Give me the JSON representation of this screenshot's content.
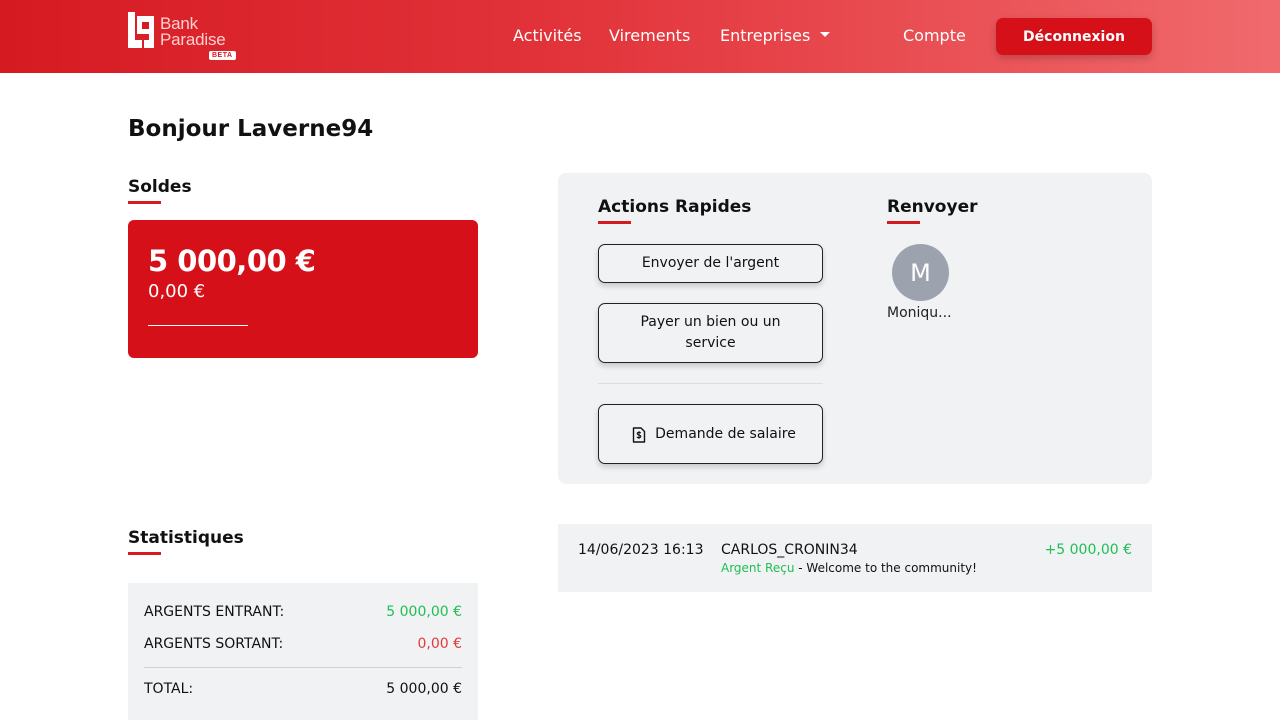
{
  "brand": {
    "line1": "Bank",
    "line2": "Paradise",
    "badge": "BETA"
  },
  "nav": {
    "activites": "Activités",
    "virements": "Virements",
    "entreprises": "Entreprises",
    "compte": "Compte",
    "logout": "Déconnexion"
  },
  "greeting": "Bonjour Laverne94",
  "soldes": {
    "title": "Soldes",
    "main": "5 000,00 €",
    "sub": "0,00 €"
  },
  "quick_actions": {
    "title": "Actions Rapides",
    "send": "Envoyer de l'argent",
    "pay": "Payer un bien ou un service",
    "salary": "Demande de salaire"
  },
  "renvoyer": {
    "title": "Renvoyer",
    "contact_initial": "M",
    "contact_name": "Moniqu..."
  },
  "stats": {
    "title": "Statistiques",
    "in_label": "ARGENTS ENTRANT:",
    "in_value": "5 000,00 €",
    "out_label": "ARGENTS SORTANT:",
    "out_value": "0,00 €",
    "total_label": "TOTAL:",
    "total_value": "5 000,00 €"
  },
  "transaction": {
    "date": "14/06/2023 16:13",
    "name": "CARLOS_CRONIN34",
    "status": "Argent Reçu",
    "message": " - Welcome to the community!",
    "amount": "+5 000,00 €"
  },
  "colors": {
    "brand_red": "#d61018",
    "positive": "#1fbf54",
    "negative": "#e23b3b",
    "panel_bg": "#f1f2f4"
  }
}
